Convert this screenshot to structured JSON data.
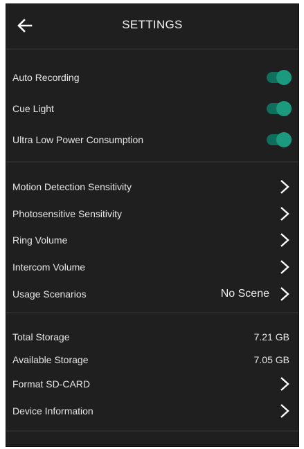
{
  "header": {
    "title": "SETTINGS"
  },
  "toggles": [
    {
      "label": "Auto Recording",
      "on": true
    },
    {
      "label": "Cue Light",
      "on": true
    },
    {
      "label": "Ultra Low Power Consumption",
      "on": true
    }
  ],
  "nav_items": [
    {
      "label": "Motion Detection Sensitivity"
    },
    {
      "label": "Photosensitive Sensitivity"
    },
    {
      "label": "Ring Volume"
    },
    {
      "label": "Intercom Volume"
    },
    {
      "label": "Usage Scenarios",
      "value": "No Scene"
    }
  ],
  "storage": {
    "total_label": "Total Storage",
    "total_value": "7.21 GB",
    "available_label": "Available Storage",
    "available_value": "7.05 GB"
  },
  "device_items": [
    {
      "label": "Format SD-CARD"
    },
    {
      "label": "Device Information"
    }
  ],
  "colors": {
    "background": "#1f1f1f",
    "toggle_on": "#1b9a80",
    "text": "#e6e6e6"
  },
  "icons": {
    "back": "arrow-left-icon",
    "chevron": "chevron-right-icon"
  }
}
